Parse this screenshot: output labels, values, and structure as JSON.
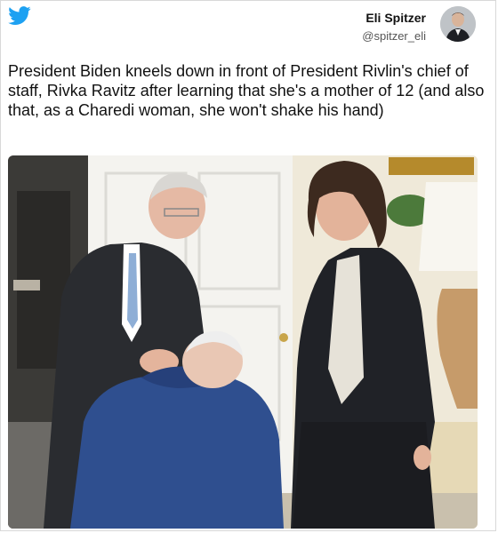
{
  "tweet": {
    "author_name": "Eli Spitzer",
    "author_handle": "@spitzer_eli",
    "text": "President Biden kneels down in front of President Rivlin's chief of staff, Rivka Ravitz after learning that she's a mother of 12 (and also that, as a Charedi woman, she won't shake his hand)"
  },
  "icons": {
    "brand": "twitter-bird-icon"
  },
  "colors": {
    "brand": "#1da1f2",
    "text": "#111111",
    "handle": "#555555"
  }
}
